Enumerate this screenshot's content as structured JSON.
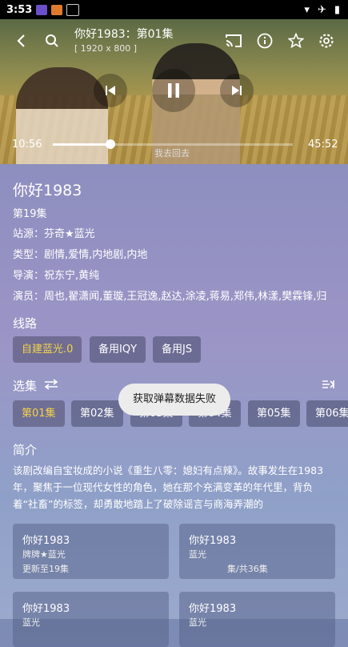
{
  "status_bar": {
    "time": "3:53",
    "battery_icon": "battery-icon",
    "wifi_icon": "wifi-icon",
    "airplane_icon": "airplane-icon"
  },
  "player": {
    "title": "你好1983：第01集",
    "resolution": "[ 1920 x 800 ]",
    "current_time": "10:56",
    "total_time": "45:52",
    "progress_fraction": 0.24,
    "subtitle": "我去回去"
  },
  "info": {
    "title": "你好1983",
    "episode": "第19集",
    "source": "站源：芬奇★蓝光",
    "genre": "类型：剧情,爱情,内地剧,内地",
    "director": "导演：祝东宁,黄纯",
    "cast": "演员：周也,翟潇闻,董璇,王冠逸,赵达,涂凌,蒋易,郑伟,林漾,樊霖锋,归"
  },
  "routes": {
    "label": "线路",
    "items": [
      "自建蓝光.0",
      "备用IQY",
      "备用JS"
    ]
  },
  "episodes": {
    "label": "选集",
    "items": [
      "第01集",
      "第02集",
      "第03集",
      "第04集",
      "第05集",
      "第06集"
    ]
  },
  "synopsis": {
    "label": "简介",
    "text": "该剧改编自宝妆成的小说《重生八零：媳妇有点辣》。故事发生在1983年，聚焦于一位现代女性的角色，她在那个充满变革的年代里，背负着“社畜”的标签，却勇敢地踏上了破除谣言与商海弄潮的"
  },
  "related": [
    {
      "title": "你好1983",
      "source": "牌牌★蓝光",
      "update": "更新至19集"
    },
    {
      "title": "你好1983",
      "source": "蓝光",
      "update": "集/共36集"
    },
    {
      "title": "你好1983",
      "source": "蓝光",
      "update": ""
    },
    {
      "title": "你好1983",
      "source": "蓝光",
      "update": ""
    }
  ],
  "toast": "获取弹幕数据失败",
  "colors": {
    "accent": "#f3d34a"
  }
}
